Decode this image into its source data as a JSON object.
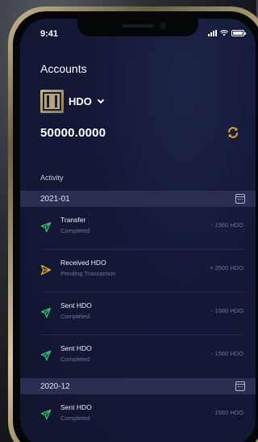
{
  "status_bar": {
    "time": "9:41"
  },
  "header": {
    "title": "Accounts"
  },
  "token": {
    "symbol": "HDO"
  },
  "balance": "50000.0000",
  "activity_label": "Activity",
  "colors": {
    "accent": "#e8a623",
    "sent_green": "#2fbf71",
    "pending_orange": "#e8a623"
  },
  "groups": [
    {
      "month": "2021-01",
      "transactions": [
        {
          "icon": "send-icon",
          "title": "Transfer",
          "status": "Completed",
          "amount": "- 1560 HDO"
        },
        {
          "icon": "receive-icon",
          "title": "Received HDO",
          "status": "Pending Transaction",
          "amount": "+ 2500 HDO"
        },
        {
          "icon": "send-icon",
          "title": "Sent HDO",
          "status": "Completed",
          "amount": "- 1560 HDO"
        },
        {
          "icon": "send-icon",
          "title": "Sent HDO",
          "status": "Completed",
          "amount": "- 1560 HDO"
        }
      ]
    },
    {
      "month": "2020-12",
      "transactions": [
        {
          "icon": "send-icon",
          "title": "Sent HDO",
          "status": "Completed",
          "amount": "- 1560 HDO"
        }
      ]
    }
  ]
}
